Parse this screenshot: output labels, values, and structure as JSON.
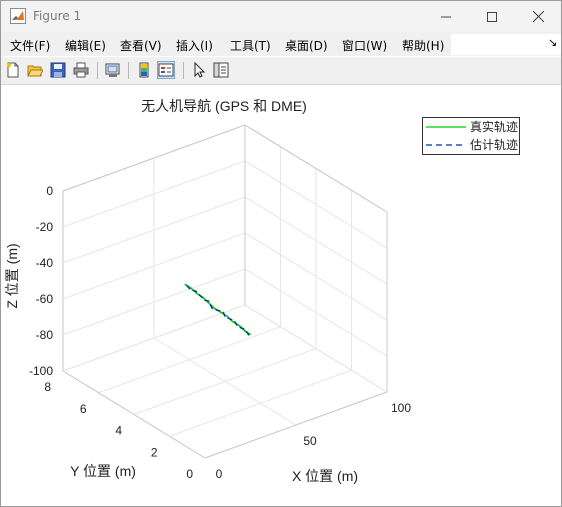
{
  "window": {
    "title": "Figure 1",
    "controls": {
      "minimize": "minimize",
      "maximize": "maximize",
      "close": "close"
    }
  },
  "menubar": {
    "items": [
      "文件(F)",
      "编辑(E)",
      "查看(V)",
      "插入(I)",
      "工具(T)",
      "桌面(D)",
      "窗口(W)",
      "帮助(H)"
    ],
    "overflow_glyph": "↘"
  },
  "toolbar": {
    "buttons": [
      {
        "icon": "new-figure-icon"
      },
      {
        "icon": "open-file-icon"
      },
      {
        "icon": "save-icon"
      },
      {
        "icon": "print-icon"
      },
      {
        "icon": "link-plot-icon"
      },
      {
        "icon": "insert-colorbar-icon"
      },
      {
        "icon": "insert-legend-icon",
        "active": true
      },
      {
        "icon": "edit-plot-pointer-icon"
      },
      {
        "icon": "property-inspector-icon"
      }
    ]
  },
  "chart_data": {
    "type": "line",
    "title": "无人机导航 (GPS 和 DME)",
    "xlabel": "X 位置 (m)",
    "ylabel": "Y 位置 (m)",
    "zlabel": "Z 位置 (m)",
    "xlim": [
      0,
      100
    ],
    "ylim": [
      0,
      8
    ],
    "zlim": [
      -100,
      0
    ],
    "xticks": [
      "0",
      "50",
      "100"
    ],
    "yticks": [
      "0",
      "2",
      "4",
      "6",
      "8"
    ],
    "zticks": [
      "0",
      "-20",
      "-40",
      "-60",
      "-80",
      "-100"
    ],
    "grid": true,
    "legend_position": "top-right",
    "series": [
      {
        "name": "真实轨迹",
        "color": "#00cc00",
        "style": "solid",
        "x": [
          24,
          28,
          32,
          36,
          40,
          44,
          48,
          52,
          56,
          60,
          64,
          68
        ],
        "y": [
          3.6,
          3.7,
          3.7,
          3.8,
          3.9,
          4.0,
          4.0,
          4.1,
          4.2,
          4.2,
          4.3,
          4.4
        ],
        "z": [
          -34,
          -38,
          -43,
          -47,
          -52,
          -57,
          -61,
          -65,
          -70,
          -74,
          -79,
          -83
        ]
      },
      {
        "name": "估计轨迹",
        "color": "#0033aa",
        "style": "dashed",
        "x": [
          24,
          28,
          32,
          36,
          40,
          44,
          48,
          52,
          56,
          60,
          64,
          68
        ],
        "y": [
          3.5,
          3.7,
          3.8,
          3.7,
          3.9,
          4.1,
          3.9,
          4.2,
          4.1,
          4.3,
          4.3,
          4.5
        ],
        "z": [
          -34,
          -39,
          -42,
          -48,
          -51,
          -58,
          -60,
          -66,
          -69,
          -75,
          -78,
          -84
        ]
      }
    ]
  }
}
